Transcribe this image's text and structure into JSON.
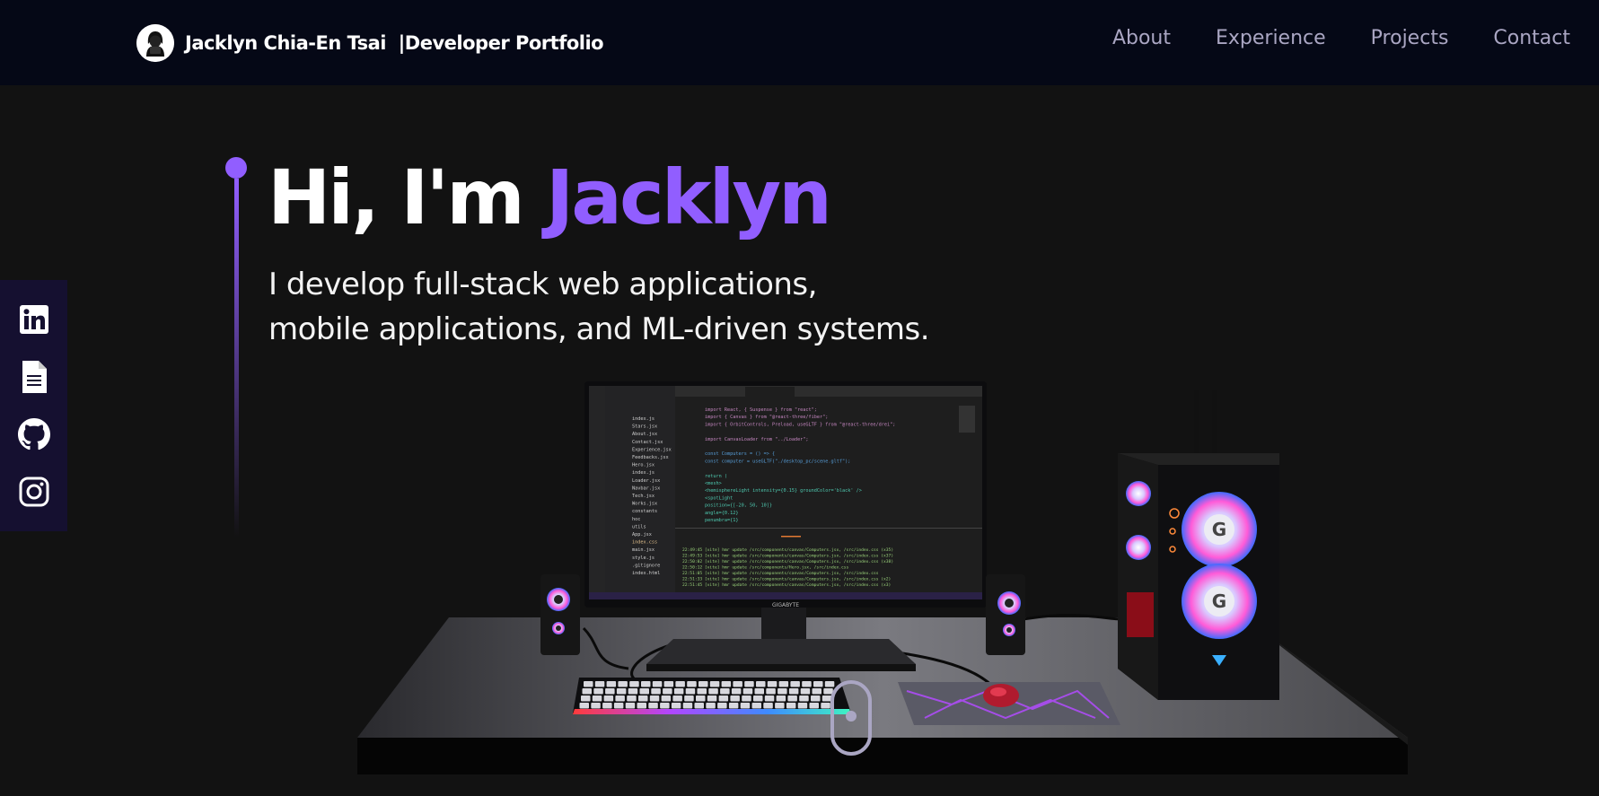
{
  "nav": {
    "brand_name": "Jacklyn Chia-En Tsai",
    "brand_suffix": "|Developer Portfolio",
    "links": [
      {
        "label": "About"
      },
      {
        "label": "Experience"
      },
      {
        "label": "Projects"
      },
      {
        "label": "Contact"
      }
    ]
  },
  "social": [
    {
      "icon": "linkedin-icon"
    },
    {
      "icon": "resume-document-icon"
    },
    {
      "icon": "github-icon"
    },
    {
      "icon": "instagram-icon"
    }
  ],
  "hero": {
    "greeting": "Hi, I'm ",
    "name": "Jacklyn",
    "line1": "I develop full-stack web applications,",
    "line2": "mobile applications, and ML-driven systems."
  },
  "scene": {
    "monitor_brand": "GIGABYTE",
    "editor_code": [
      "import React, { Suspense } from \"react\";",
      "import { Canvas } from \"@react-three/fiber\";",
      "import { OrbitControls, Preload, useGLTF } from \"@react-three/drei\";",
      "",
      "import CanvasLoader from \"../Loader\";",
      "",
      "const Computers = () => {",
      "  const computer = useGLTF(\"./desktop_pc/scene.gltf\");",
      "",
      "  return (",
      "    <mesh>",
      "      <hemisphereLight intensity={0.15} groundColor='black' />",
      "      <spotLight",
      "        position={[-20, 50, 10]}",
      "        angle={0.12}",
      "        penumbra={1}"
    ],
    "editor_files": [
      "index.js",
      "Stars.jsx",
      "About.jsx",
      "Contact.jsx",
      "Experience.jsx",
      "Feedbacks.jsx",
      "Hero.jsx",
      "index.js",
      "Loader.jsx",
      "Navbar.jsx",
      "Tech.jsx",
      "Works.jsx",
      "constants",
      "hoc",
      "utils",
      "App.jsx",
      "index.css",
      "main.jsx",
      "style.js",
      ".gitignore",
      "index.html"
    ],
    "terminal_lines": [
      "22:49:45 [vite] hmr update /src/components/canvas/Computers.jsx, /src/index.css (x35)",
      "22:49:53 [vite] hmr update /src/components/canvas/Computers.jsx, /src/index.css (x37)",
      "22:50:02 [vite] hmr update /src/components/canvas/Computers.jsx, /src/index.css (x38)",
      "22:50:12 [vite] hmr update /src/components/Hero.jsx, /src/index.css",
      "22:51:05 [vite] hmr update /src/components/canvas/Computers.jsx, /src/index.css",
      "22:51:33 [vite] hmr update /src/components/canvas/Computers.jsx, /src/index.css (x2)",
      "22:51:45 [vite] hmr update /src/components/canvas/Computers.jsx, /src/index.css (x3)"
    ]
  },
  "colors": {
    "accent": "#915eff",
    "nav_bg": "#050816",
    "page_bg": "#121212",
    "secondary_text": "#aaa6c3",
    "sidebar_bg": "#151030"
  }
}
